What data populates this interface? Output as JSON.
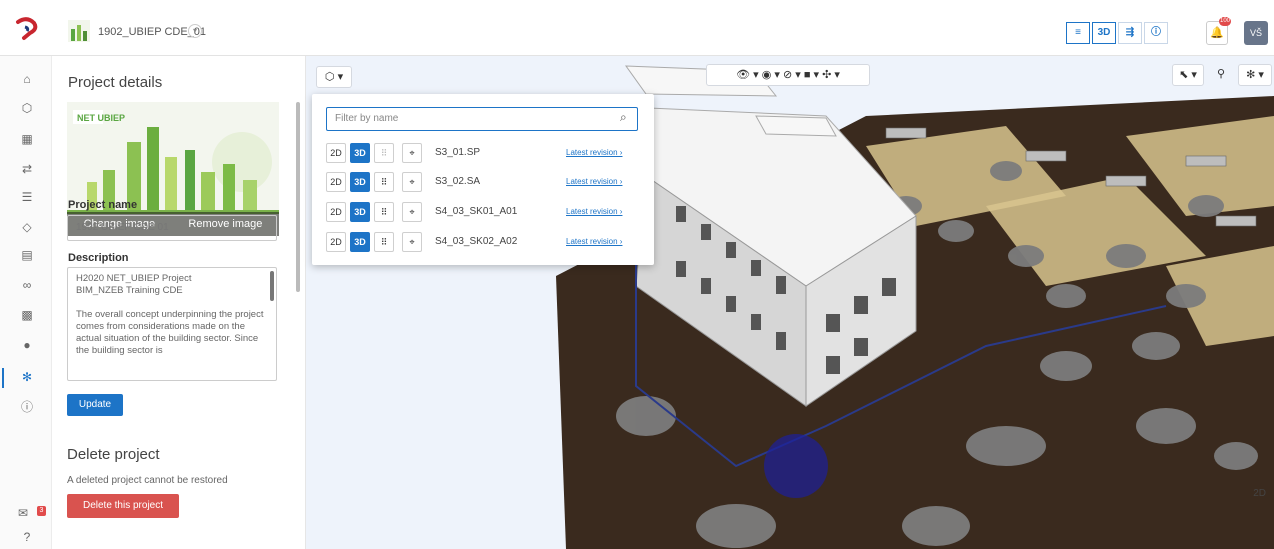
{
  "header": {
    "project_title": "1902_UBIEP CDE_01",
    "view_buttons": [
      "≡",
      "3D",
      "⇶",
      "ⓘ"
    ],
    "notification_count": "100",
    "user_initials": "VŠ"
  },
  "rail_icons": [
    "dashboard-icon",
    "cube-icon",
    "save-icon",
    "flow-icon",
    "list-icon",
    "tag-icon",
    "calendar-icon",
    "link-icon",
    "grid-icon",
    "person-icon",
    "settings-icon",
    "info-icon",
    "mail-icon",
    "help-icon"
  ],
  "details": {
    "title": "Project details",
    "change_image": "Change image",
    "remove_image": "Remove image",
    "project_name_label": "Project name",
    "project_name_value": "1902 UBIEP CDE 01",
    "description_label": "Description",
    "description_value": "H2020 NET_UBIEP Project\nBIM_NZEB Training CDE\n\nThe overall concept underpinning the project comes from considerations made on the actual situation of the building sector. Since the building sector is",
    "update_label": "Update",
    "delete_title": "Delete project",
    "delete_note": "A deleted project cannot be restored",
    "delete_button": "Delete this project",
    "logo_text": "NET UBIEP"
  },
  "viewer": {
    "models_button": "⬡ ▾",
    "corner_label": "2D",
    "filter_placeholder": "Filter by name",
    "models": [
      {
        "name": "S3_01.SP",
        "link": "Latest revision ›"
      },
      {
        "name": "S3_02.SA",
        "link": "Latest revision ›"
      },
      {
        "name": "S4_03_SK01_A01",
        "link": "Latest revision ›"
      },
      {
        "name": "S4_03_SK02_A02",
        "link": "Latest revision ›"
      }
    ],
    "mode_2d": "2D",
    "mode_3d": "3D"
  },
  "colors": {
    "accent": "#1d74c7",
    "danger": "#d9534f",
    "ground": "#3a2a1e"
  }
}
